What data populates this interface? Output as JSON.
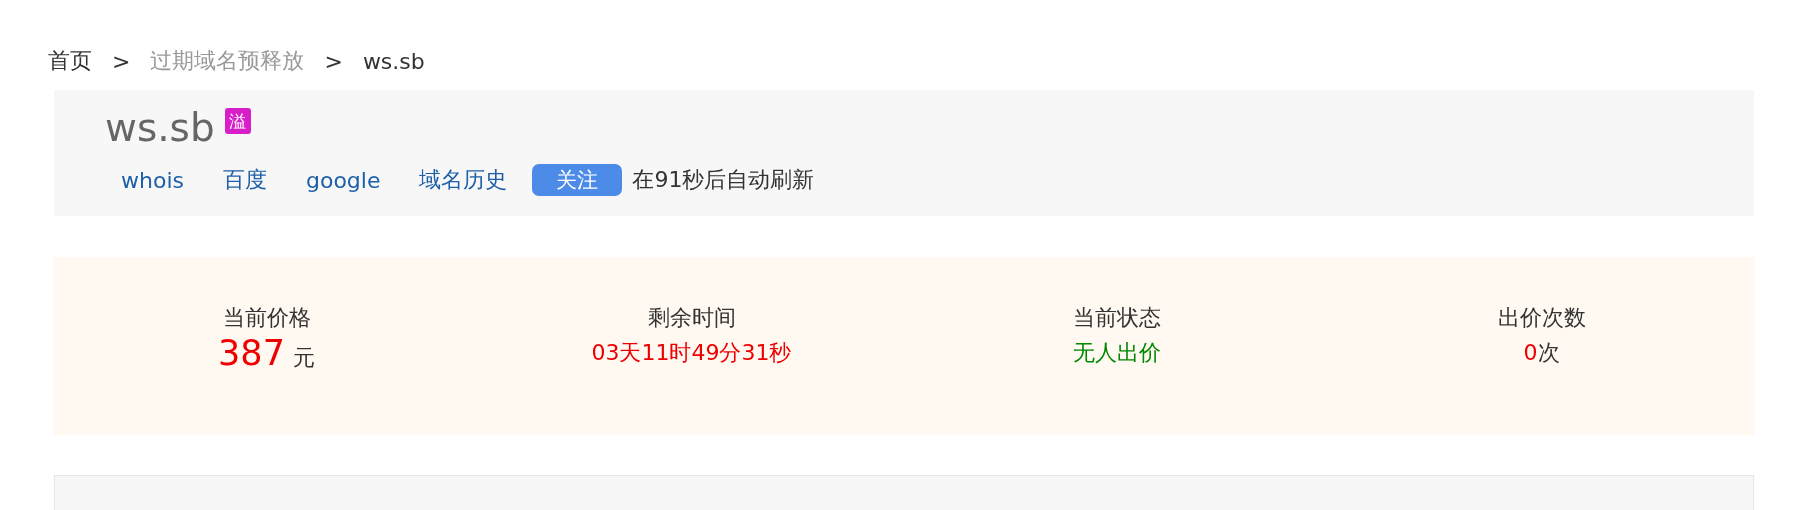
{
  "breadcrumb_separator": ">",
  "breadcrumb": [
    {
      "label": "首页",
      "kind": "link"
    },
    {
      "label": "过期域名预释放",
      "kind": "muted"
    },
    {
      "label": "ws.sb",
      "kind": "current"
    }
  ],
  "domain": {
    "name": "ws.sb",
    "badge": "溢"
  },
  "links": [
    "whois",
    "百度",
    "google",
    "域名历史"
  ],
  "follow_button": "关注",
  "refresh_note": "在91秒后自动刷新",
  "stats": [
    {
      "label": "当前价格",
      "kind": "price",
      "value": "387",
      "unit": "元"
    },
    {
      "label": "剩余时间",
      "kind": "time",
      "value": "03天11时49分31秒"
    },
    {
      "label": "当前状态",
      "kind": "status",
      "value": "无人出价"
    },
    {
      "label": "出价次数",
      "kind": "count",
      "value": "0",
      "unit": "次"
    }
  ]
}
